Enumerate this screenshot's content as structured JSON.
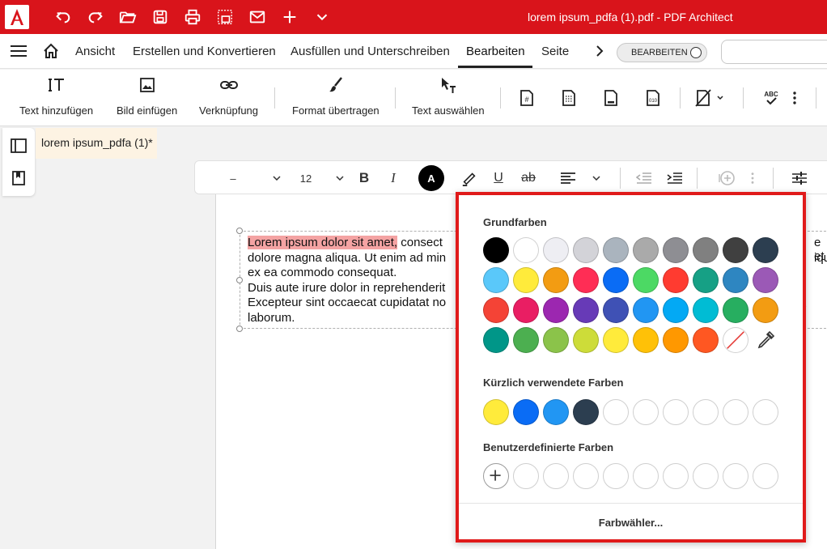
{
  "app": {
    "logo": "A",
    "window_title": "lorem ipsum_pdfa (1).pdf  -  PDF Architect"
  },
  "quick_access": [
    "undo-icon",
    "redo-icon",
    "open-folder-icon",
    "save-icon",
    "print-icon",
    "scan-icon",
    "mail-icon",
    "plus-icon",
    "chevron-down-icon"
  ],
  "menu": {
    "items": [
      "Ansicht",
      "Erstellen und Konvertieren",
      "Ausfüllen und Unterschreiben",
      "Bearbeiten",
      "Seite"
    ],
    "active": "Bearbeiten",
    "edit_toggle_label": "BEARBEITEN"
  },
  "ribbon": {
    "add_text": "Text hinzufügen",
    "insert_image": "Bild einfügen",
    "link": "Verknüpfung",
    "format_painter": "Format übertragen",
    "select_text": "Text auswählen"
  },
  "doc_tab": {
    "title": "lorem ipsum_pdfa (1)*"
  },
  "format_bar": {
    "font_size": "12",
    "font_color_letter": "A"
  },
  "document": {
    "lines": [
      {
        "highlight": "Lorem ipsum dolor sit amet,",
        "rest": " consect"
      },
      {
        "highlight": "",
        "rest": "dolore magna aliqua. Ut enim ad min"
      },
      {
        "highlight": "",
        "rest": "ex ea commodo consequat."
      },
      {
        "highlight": "",
        "rest": "Duis aute irure dolor in reprehenderit"
      },
      {
        "highlight": "",
        "rest": "Excepteur sint occaecat cupidatat no"
      },
      {
        "highlight": "",
        "rest": "laborum."
      }
    ],
    "right_fragments": [
      "e et",
      "iqui",
      "t"
    ]
  },
  "color_popup": {
    "basic_title": "Grundfarben",
    "basic_colors": [
      [
        "#000000",
        "#ffffff",
        "#eeeef3",
        "#d3d3d8",
        "#aab4be",
        "#aaaaaa",
        "#8e8e93",
        "#808080",
        "#404040",
        "#2c3e50"
      ],
      [
        "#5ac8fa",
        "#ffeb3b",
        "#f39c12",
        "#ff2d55",
        "#0a6cf5",
        "#4cd964",
        "#ff3b30",
        "#16a085",
        "#2e86c1",
        "#9b59b6"
      ],
      [
        "#f44336",
        "#e91e63",
        "#9c27b0",
        "#673ab7",
        "#3f51b5",
        "#2196f3",
        "#03a9f4",
        "#00bcd4",
        "#27ae60",
        "#f39c12"
      ],
      [
        "#009688",
        "#4caf50",
        "#8bc34a",
        "#cddc39",
        "#ffeb3b",
        "#ffc107",
        "#ff9800",
        "#ff5722",
        "none",
        "eyedropper"
      ]
    ],
    "recent_title": "Kürzlich verwendete Farben",
    "recent_colors": [
      "#ffeb3b",
      "#0a6cf5",
      "#2196f3",
      "#2c3e50",
      "",
      "",
      "",
      "",
      "",
      ""
    ],
    "custom_title": "Benutzerdefinierte Farben",
    "custom_colors": [
      "add",
      "",
      "",
      "",
      "",
      "",
      "",
      "",
      "",
      ""
    ],
    "picker_label": "Farbwähler..."
  }
}
